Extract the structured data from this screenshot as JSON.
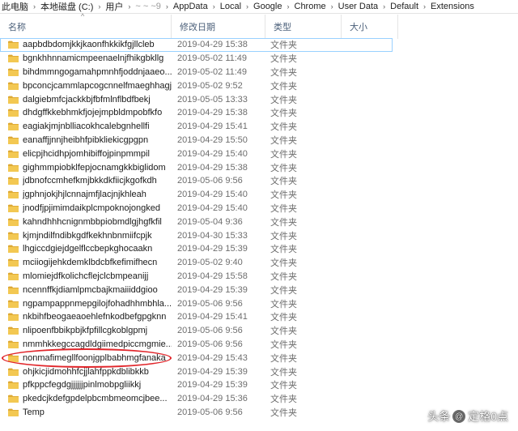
{
  "breadcrumb": [
    {
      "label": "此电脑",
      "masked": false
    },
    {
      "label": "本地磁盘 (C:)",
      "masked": false
    },
    {
      "label": "用户",
      "masked": false
    },
    {
      "label": "~ ~ ~9",
      "masked": true
    },
    {
      "label": "AppData",
      "masked": false
    },
    {
      "label": "Local",
      "masked": false
    },
    {
      "label": "Google",
      "masked": false
    },
    {
      "label": "Chrome",
      "masked": false
    },
    {
      "label": "User Data",
      "masked": false
    },
    {
      "label": "Default",
      "masked": false
    },
    {
      "label": "Extensions",
      "masked": false
    }
  ],
  "columns": {
    "name": "名称",
    "date": "修改日期",
    "type": "类型",
    "size": "大小"
  },
  "rows": [
    {
      "name": "aapbdbdomjkkjkaonfhkkikfgjllcleb",
      "date": "2019-04-29 15:38",
      "type": "文件夹"
    },
    {
      "name": "bgnkhhnnamicmpeenaelnjfhikgbkllg",
      "date": "2019-05-02 11:49",
      "type": "文件夹"
    },
    {
      "name": "bihdmmngogamahpmnhfjoddnjaaeo...",
      "date": "2019-05-02 11:49",
      "type": "文件夹"
    },
    {
      "name": "bpconcjcammlapcogcnnelfmaeghhagj",
      "date": "2019-05-02 9:52",
      "type": "文件夹"
    },
    {
      "name": "dalgiebmfcjackkbjfbfmlnflbdfbekj",
      "date": "2019-05-05 13:33",
      "type": "文件夹"
    },
    {
      "name": "dhdgffkkebhmkfjojejmpbldmpobfkfo",
      "date": "2019-04-29 15:38",
      "type": "文件夹"
    },
    {
      "name": "eagiakjmjnblliacokhcalebgnhellfi",
      "date": "2019-04-29 15:41",
      "type": "文件夹"
    },
    {
      "name": "eanaffjjnnjheibhfpibkliekicgpgpn",
      "date": "2019-04-29 15:50",
      "type": "文件夹"
    },
    {
      "name": "elicpjhcidhpjomhibiffojpinpmmpil",
      "date": "2019-04-29 15:40",
      "type": "文件夹"
    },
    {
      "name": "gighmmpiobklfepjocnamgkkbiglidom",
      "date": "2019-04-29 15:38",
      "type": "文件夹"
    },
    {
      "name": "jdbnofccmhefkmjbkkdkfiicjkgofkdh",
      "date": "2019-05-06 9:56",
      "type": "文件夹"
    },
    {
      "name": "jgphnjokjhjlcnnajmfjlacjnjkhleah",
      "date": "2019-04-29 15:40",
      "type": "文件夹"
    },
    {
      "name": "jnodfjpjimimdaikplcmpoknojongked",
      "date": "2019-04-29 15:40",
      "type": "文件夹"
    },
    {
      "name": "kahndhhhcnignmbbpiobmdlgjhgfkfil",
      "date": "2019-05-04 9:36",
      "type": "文件夹"
    },
    {
      "name": "kjmjndilfndibkgdfkekhnbnmiifcpjk",
      "date": "2019-04-30 15:33",
      "type": "文件夹"
    },
    {
      "name": "lhgiccdgiejdgelflccbepkghocaakn",
      "date": "2019-04-29 15:39",
      "type": "文件夹"
    },
    {
      "name": "mciiogijehkdemklbdcbfkefimifhecn",
      "date": "2019-05-02 9:40",
      "type": "文件夹"
    },
    {
      "name": "mlomiejdfkolichcflejclcbmpeanijj",
      "date": "2019-04-29 15:58",
      "type": "文件夹"
    },
    {
      "name": "ncennffkjdiamlpmcbajkmaiiiddgioo",
      "date": "2019-04-29 15:39",
      "type": "文件夹"
    },
    {
      "name": "ngpampappnmepgilojfohadhhmbhla...",
      "date": "2019-05-06 9:56",
      "type": "文件夹"
    },
    {
      "name": "nkbihfbeogaeaoehlefnkodbefgpgknn",
      "date": "2019-04-29 15:41",
      "type": "文件夹"
    },
    {
      "name": "nlipoenfbbikpbjkfpfillcgkoblgpmj",
      "date": "2019-05-06 9:56",
      "type": "文件夹"
    },
    {
      "name": "nmmhkkegccagdldgiimedpiccmgmie...",
      "date": "2019-05-06 9:56",
      "type": "文件夹"
    },
    {
      "name": "nonmafimegllfoonjgplbabhmgfanaka",
      "date": "2019-04-29 15:43",
      "type": "文件夹"
    },
    {
      "name": "ohjkicjidmohhfcjjlahfppkdblibkkb",
      "date": "2019-04-29 15:39",
      "type": "文件夹"
    },
    {
      "name": "pfkppcfegdgjjjjjjpinlmobpgliikkj",
      "date": "2019-04-29 15:39",
      "type": "文件夹"
    },
    {
      "name": "pkedcjkdefgpdelpbcmbmeomcjbee...",
      "date": "2019-04-29 15:36",
      "type": "文件夹"
    },
    {
      "name": "Temp",
      "date": "2019-05-06 9:56",
      "type": "文件夹"
    }
  ],
  "selected_index": 0,
  "highlighted_index": 23,
  "colors": {
    "folder": "#f3c852",
    "folder_dark": "#dba630",
    "highlight": "#e1262b",
    "header_text": "#4c607a",
    "selection_border": "#99d1ff"
  },
  "watermark": {
    "prefix": "头条",
    "at": "@",
    "suffix": "定格0点"
  }
}
